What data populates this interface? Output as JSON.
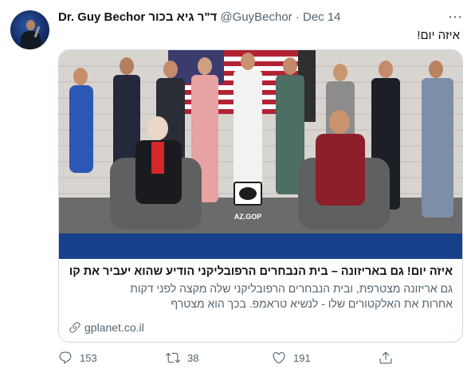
{
  "tweet": {
    "author_name": "Dr. Guy Bechor ד\"ר גיא בכור",
    "handle": "@GuyBechor",
    "separator": "·",
    "date": "Dec 14",
    "more_icon": "more-icon",
    "text": "איזה יום!"
  },
  "card": {
    "image_caption": "AZ.GOP",
    "title": "איזה יום! גם באריזונה – בית הנבחרים הרפובליקני הודיע שהוא יעביר את קו...",
    "description_line1": "גם אריזונה מצטרפת, ובית הנבחרים הרפובליקני שלה מקצה לפני דקות",
    "description_line2": "אחרות את האלקטורים שלו - לנשיא טראמפ. בכך הוא מצטרף",
    "domain": "gplanet.co.il",
    "link_icon": "link-icon"
  },
  "actions": {
    "reply_count": "153",
    "retweet_count": "38",
    "like_count": "191"
  },
  "colors": {
    "text": "#0f1419",
    "secondary": "#536471",
    "border": "#cfd9de",
    "banner_blue": "#16408a"
  }
}
